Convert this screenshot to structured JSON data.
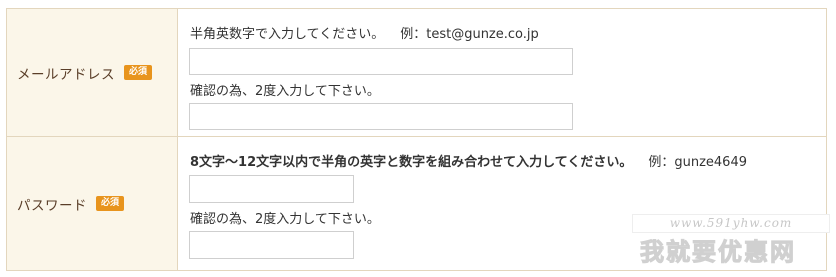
{
  "email": {
    "label": "メールアドレス",
    "required_badge": "必須",
    "instruction": "半角英数字で入力してください。",
    "example": "例：test@gunze.co.jp",
    "value": "",
    "confirm_label": "確認の為、2度入力して下さい。",
    "confirm_value": ""
  },
  "password": {
    "label": "パスワード",
    "required_badge": "必須",
    "instruction": "8文字～12文字以内で半角の英字と数字を組み合わせて入力してください。",
    "example": "例：gunze4649",
    "value": "",
    "confirm_label": "確認の為、2度入力して下さい。",
    "confirm_value": ""
  },
  "watermark": {
    "url": "www.591yhw.com",
    "text": "我就要优惠网"
  },
  "colors": {
    "required_badge": "#e8941d",
    "label_bg": "#fbf6e9",
    "border": "#e3d6bd"
  }
}
